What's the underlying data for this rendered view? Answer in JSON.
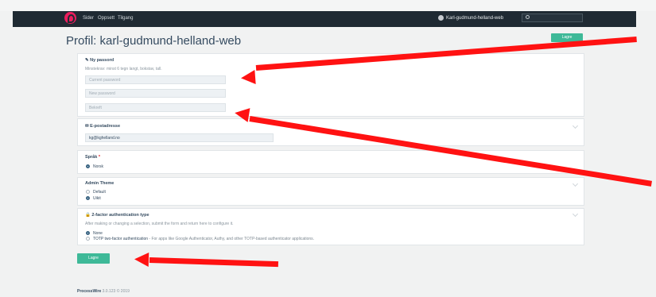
{
  "nav": {
    "items": [
      "Sider",
      "Oppsett",
      "Tilgang"
    ],
    "user": "Karl-gudmund-helland-web"
  },
  "page": {
    "title": "Profil: karl-gudmund-helland-web",
    "save_label": "Lagre"
  },
  "password": {
    "heading": "Ny passord",
    "hint": "Minstekrav: minst 6 tegn langt, bokstav, tall.",
    "current_placeholder": "Current password",
    "new_placeholder": "New password",
    "confirm_placeholder": "Bekreft"
  },
  "email": {
    "heading": "E-postadresse",
    "value": "kg@kghelland.no"
  },
  "language": {
    "heading": "Språk",
    "required_mark": "*",
    "option": "Norsk"
  },
  "theme": {
    "heading": "Admin Theme",
    "options": [
      "Default",
      "Uikit"
    ]
  },
  "two_factor": {
    "heading": "2-factor authentication type",
    "hint": "After making or changing a selection, submit the form and return here to configure it.",
    "option_none": "None",
    "option_totp_label": "TOTP two-factor authentication",
    "option_totp_desc": " - For apps like Google Authenticator, Authy, and other TOTP-based authenticator applications."
  },
  "footer": {
    "brand": "ProcessWire",
    "version": "3.0.123 © 2019"
  },
  "colors": {
    "accent": "#3eb998",
    "topbar": "#1f2a33",
    "annotation_arrow": "#ff1212"
  }
}
